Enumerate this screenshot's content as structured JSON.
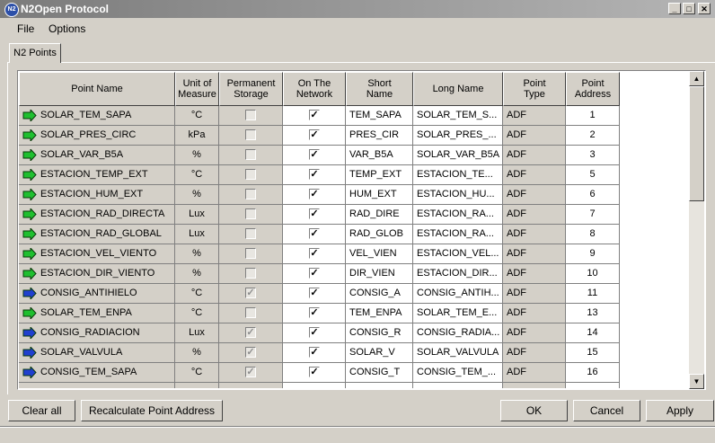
{
  "window": {
    "title": "N2Open Protocol",
    "icon": "n2-app-icon",
    "icon_text": "N2"
  },
  "menu": [
    "File",
    "Options"
  ],
  "tabs": [
    "N2 Points"
  ],
  "columns": [
    {
      "label": "Point Name"
    },
    {
      "label": "Unit of\nMeasure"
    },
    {
      "label": "Permanent\nStorage"
    },
    {
      "label": "On The\nNetwork"
    },
    {
      "label": "Short\nName"
    },
    {
      "label": "Long Name"
    },
    {
      "label": "Point\nType"
    },
    {
      "label": "Point\nAddress"
    }
  ],
  "colors": {
    "output_icon": "#1fbf2f",
    "input_icon": "#1f3fcf"
  },
  "rows": [
    {
      "icon": "output-arrow-icon",
      "name": "SOLAR_TEM_SAPA",
      "unit": "°C",
      "permanent": false,
      "perm_disabled": true,
      "network": true,
      "short": "TEM_SAPA",
      "long": "SOLAR_TEM_S...",
      "type": "ADF",
      "address": "1"
    },
    {
      "icon": "output-arrow-icon",
      "name": "SOLAR_PRES_CIRC",
      "unit": "kPa",
      "permanent": false,
      "perm_disabled": true,
      "network": true,
      "short": "PRES_CIR",
      "long": "SOLAR_PRES_...",
      "type": "ADF",
      "address": "2"
    },
    {
      "icon": "output-arrow-icon",
      "name": "SOLAR_VAR_B5A",
      "unit": "%",
      "permanent": false,
      "perm_disabled": true,
      "network": true,
      "short": "VAR_B5A",
      "long": "SOLAR_VAR_B5A",
      "type": "ADF",
      "address": "3"
    },
    {
      "icon": "output-arrow-icon",
      "name": "ESTACION_TEMP_EXT",
      "unit": "°C",
      "permanent": false,
      "perm_disabled": true,
      "network": true,
      "short": "TEMP_EXT",
      "long": "ESTACION_TE...",
      "type": "ADF",
      "address": "5"
    },
    {
      "icon": "output-arrow-icon",
      "name": "ESTACION_HUM_EXT",
      "unit": "%",
      "permanent": false,
      "perm_disabled": true,
      "network": true,
      "short": "HUM_EXT",
      "long": "ESTACION_HU...",
      "type": "ADF",
      "address": "6"
    },
    {
      "icon": "output-arrow-icon",
      "name": "ESTACION_RAD_DIRECTA",
      "unit": "Lux",
      "permanent": false,
      "perm_disabled": true,
      "network": true,
      "short": "RAD_DIRE",
      "long": "ESTACION_RA...",
      "type": "ADF",
      "address": "7"
    },
    {
      "icon": "output-arrow-icon",
      "name": "ESTACION_RAD_GLOBAL",
      "unit": "Lux",
      "permanent": false,
      "perm_disabled": true,
      "network": true,
      "short": "RAD_GLOB",
      "long": "ESTACION_RA...",
      "type": "ADF",
      "address": "8"
    },
    {
      "icon": "output-arrow-icon",
      "name": "ESTACION_VEL_VIENTO",
      "unit": "%",
      "permanent": false,
      "perm_disabled": true,
      "network": true,
      "short": "VEL_VIEN",
      "long": "ESTACION_VEL...",
      "type": "ADF",
      "address": "9"
    },
    {
      "icon": "output-arrow-icon",
      "name": "ESTACION_DIR_VIENTO",
      "unit": "%",
      "permanent": false,
      "perm_disabled": true,
      "network": true,
      "short": "DIR_VIEN",
      "long": "ESTACION_DIR...",
      "type": "ADF",
      "address": "10"
    },
    {
      "icon": "input-arrow-icon",
      "name": "CONSIG_ANTIHIELO",
      "unit": "°C",
      "permanent": true,
      "perm_disabled": true,
      "network": true,
      "short": "CONSIG_A",
      "long": "CONSIG_ANTIH...",
      "type": "ADF",
      "address": "11"
    },
    {
      "icon": "output-arrow-icon",
      "name": "SOLAR_TEM_ENPA",
      "unit": "°C",
      "permanent": false,
      "perm_disabled": true,
      "network": true,
      "short": "TEM_ENPA",
      "long": "SOLAR_TEM_E...",
      "type": "ADF",
      "address": "13"
    },
    {
      "icon": "input-arrow-icon",
      "name": "CONSIG_RADIACION",
      "unit": "Lux",
      "permanent": true,
      "perm_disabled": true,
      "network": true,
      "short": "CONSIG_R",
      "long": "CONSIG_RADIA...",
      "type": "ADF",
      "address": "14"
    },
    {
      "icon": "input-arrow-icon",
      "name": "SOLAR_VALVULA",
      "unit": "%",
      "permanent": true,
      "perm_disabled": true,
      "network": true,
      "short": "SOLAR_V",
      "long": "SOLAR_VALVULA",
      "type": "ADF",
      "address": "15"
    },
    {
      "icon": "input-arrow-icon",
      "name": "CONSIG_TEM_SAPA",
      "unit": "°C",
      "permanent": true,
      "perm_disabled": true,
      "network": true,
      "short": "CONSIG_T",
      "long": "CONSIG_TEM_...",
      "type": "ADF",
      "address": "16"
    }
  ],
  "buttons": {
    "clear_all": "Clear all",
    "recalculate": "Recalculate Point Address",
    "ok": "OK",
    "cancel": "Cancel",
    "apply": "Apply"
  }
}
